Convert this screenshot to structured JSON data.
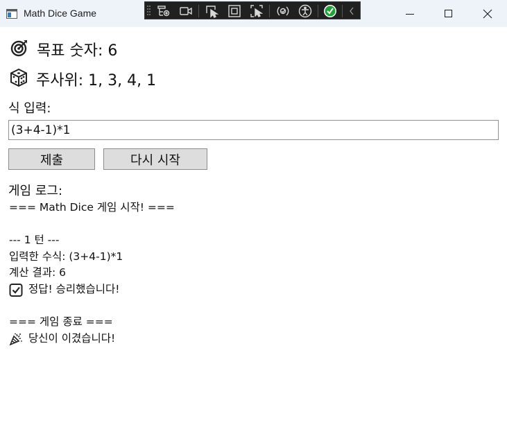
{
  "window": {
    "title": "Math Dice Game",
    "controls": [
      "minimize",
      "maximize",
      "close"
    ]
  },
  "debug_toolbar": {
    "icons": [
      "live-visual-tree-icon",
      "video-record-icon",
      "select-element-icon",
      "display-layout-adorners-icon",
      "track-focus-icon",
      "hot-reload-icon",
      "accessibility-icon",
      "binding-check-icon",
      "collapse-chevron-icon"
    ],
    "colors": {
      "background": "#202020",
      "check": "#22a33a"
    }
  },
  "game": {
    "target_label": "목표 숫자: 6",
    "target_icon": "direct-hit-target-icon",
    "dice_label": "주사위: 1, 3, 4, 1",
    "dice_icon": "game-die-icon",
    "expression_label": "식 입력:",
    "expression_value": "(3+4-1)*1",
    "submit_label": "제출",
    "restart_label": "다시 시작",
    "log_label": "게임 로그:",
    "log": [
      {
        "text": "=== Math Dice 게임 시작! ==="
      },
      {
        "text": ""
      },
      {
        "text": "--- 1 턴 ---"
      },
      {
        "text": "입력한 수식: (3+4-1)*1"
      },
      {
        "text": "계산 결과: 6"
      },
      {
        "text": "정답! 승리했습니다!",
        "icon": "check-box-icon"
      },
      {
        "text": ""
      },
      {
        "text": "=== 게임 종료 ==="
      },
      {
        "text": "당신이 이겼습니다!",
        "icon": "party-popper-icon"
      }
    ]
  }
}
